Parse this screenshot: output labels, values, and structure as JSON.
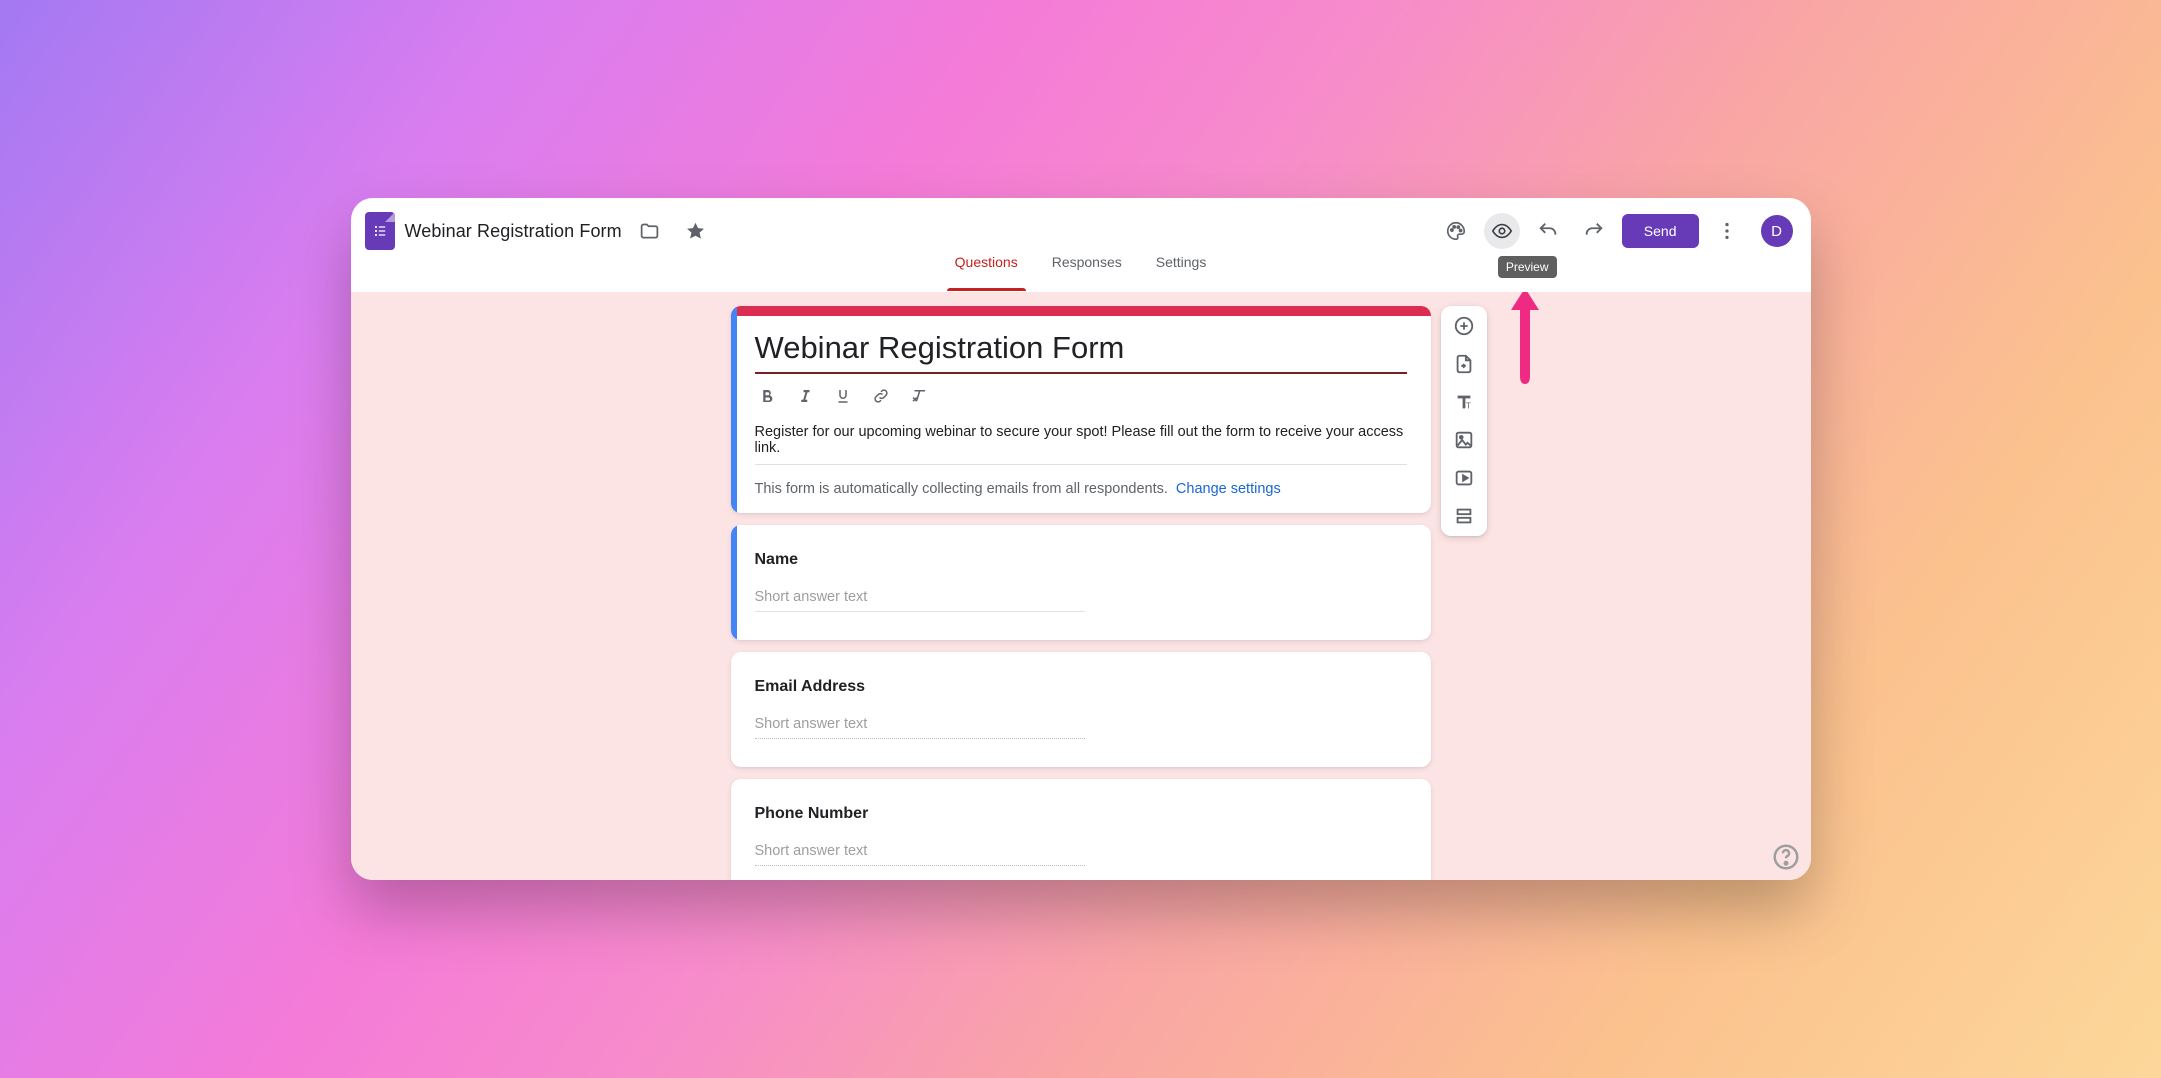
{
  "header": {
    "doc_title": "Webinar Registration Form",
    "send_label": "Send",
    "avatar_initial": "D",
    "preview_tooltip": "Preview"
  },
  "tabs": {
    "questions": "Questions",
    "responses": "Responses",
    "settings": "Settings"
  },
  "form": {
    "title": "Webinar Registration Form",
    "description": "Register for our upcoming webinar to secure your spot! Please fill out the form to receive your access link.",
    "collect_msg": "This form is automatically collecting emails from all respondents.",
    "change_settings": "Change settings"
  },
  "questions": [
    {
      "label": "Name",
      "placeholder": "Short answer text",
      "selected": true
    },
    {
      "label": "Email Address",
      "placeholder": "Short answer text",
      "selected": false
    },
    {
      "label": "Phone Number",
      "placeholder": "Short answer text",
      "selected": false
    }
  ],
  "side_tools": [
    "add-question",
    "import-questions",
    "add-title",
    "add-image",
    "add-video",
    "add-section"
  ]
}
